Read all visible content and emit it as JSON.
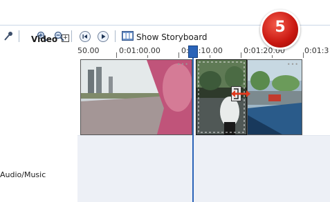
{
  "toolbar": {
    "storyboard_label": "Show Storyboard",
    "icons": [
      "microphone-icon",
      "zoom-in-icon",
      "zoom-out-icon",
      "rewind-icon",
      "play-icon",
      "storyboard-icon"
    ]
  },
  "ruler": {
    "labels": [
      "50.00",
      "0:01:00.00",
      "0:01:10.00",
      "0:01:20.00",
      "0:01:3"
    ]
  },
  "tracks": {
    "video_label": "Video",
    "expand_symbol": "+",
    "audio_label": "Audio/Music"
  },
  "badge": {
    "number": "5"
  },
  "colors": {
    "playhead": "#2a63b8",
    "badge": "#c8160f",
    "trim_arrow": "#e03a1e",
    "audio_track_bg": "#edf0f6"
  }
}
